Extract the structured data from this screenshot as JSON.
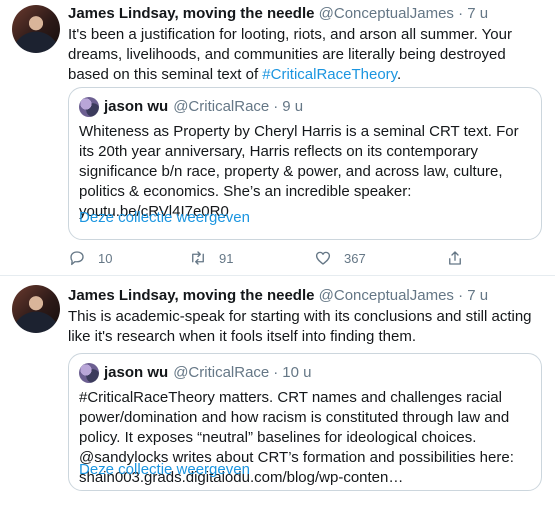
{
  "tweets": [
    {
      "author_name": "James Lindsay, moving the needle",
      "author_handle": "@ConceptualJames",
      "separator": "·",
      "time": "7 u",
      "text_before": "It's been a justification for looting, riots, and arson all summer. Your dreams, livelihoods, and communities are literally being destroyed based on this seminal text of ",
      "hashtag": "#CriticalRaceTheory",
      "text_after": ".",
      "quote": {
        "name": "jason wu",
        "handle": "@CriticalRace",
        "separator": "·",
        "time": "9 u",
        "text": "Whiteness as Property by Cheryl Harris is a seminal CRT text. For its 20th year anniversary, Harris reflects on its contemporary significance b/n race, property & power, and across law, culture, politics & economics. She’s an incredible speaker:",
        "link": "youtu.be/cRVl4I7e0R0",
        "show_more": "Deze collectie weergeven"
      },
      "actions": {
        "reply_count": "10",
        "retweet_count": "91",
        "like_count": "367",
        "icons": [
          "reply-icon",
          "retweet-icon",
          "like-icon",
          "share-icon"
        ]
      }
    },
    {
      "author_name": "James Lindsay, moving the needle",
      "author_handle": "@ConceptualJames",
      "separator": "·",
      "time": "7 u",
      "text": "This is academic-speak for starting with its conclusions and still acting like it's research when it fools itself into finding them.",
      "quote": {
        "name": "jason wu",
        "handle": "@CriticalRace",
        "separator": "·",
        "time": "10 u",
        "text": "#CriticalRaceTheory matters. CRT names and challenges racial power/domination and how racism is constituted through law and policy. It exposes “neutral” baselines for ideological choices. @sandylocks writes about CRT’s formation and possibilities here: shain003.grads.digitalodu.com/blog/wp-conten…",
        "show_more": "Deze collectie weergeven"
      }
    }
  ],
  "colors": {
    "text": "#14171a",
    "secondary": "#657786",
    "link": "#1b95e0",
    "border": "#ccd6dd",
    "divider": "#e6ecf0"
  }
}
